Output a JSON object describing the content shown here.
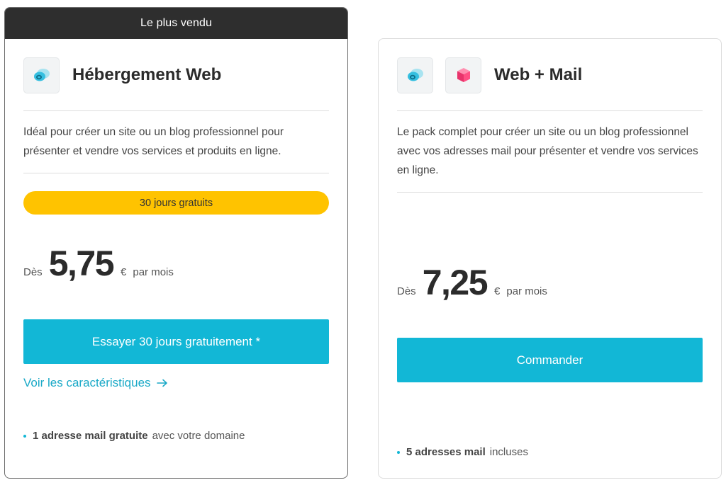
{
  "colors": {
    "accent": "#12b7d6",
    "badge": "#ffc300",
    "banner": "#2e2e2e",
    "link": "#1aa9c7"
  },
  "cards": [
    {
      "banner": "Le plus vendu",
      "icons": [
        "cloud-icon"
      ],
      "title": "Hébergement Web",
      "description": "Idéal pour créer un site ou un blog professionnel pour présenter et vendre vos services et produits en ligne.",
      "badge": "30 jours gratuits",
      "price": {
        "from": "Dès",
        "amount": "5,75",
        "currency": "€",
        "period": "par mois"
      },
      "cta": "Essayer 30 jours gratuitement *",
      "link": "Voir les caractéristiques",
      "link_icon": "arrow-right-icon",
      "feature": {
        "strong": "1 adresse mail gratuite",
        "rest": "avec votre domaine"
      }
    },
    {
      "icons": [
        "cloud-icon",
        "mail-cube-icon"
      ],
      "title": "Web + Mail",
      "description": "Le pack complet pour créer un site ou un blog professionnel avec vos adresses mail pour présenter et vendre vos services en ligne.",
      "price": {
        "from": "Dès",
        "amount": "7,25",
        "currency": "€",
        "period": "par mois"
      },
      "cta": "Commander",
      "feature": {
        "strong": "5 adresses mail",
        "rest": "incluses"
      }
    }
  ]
}
